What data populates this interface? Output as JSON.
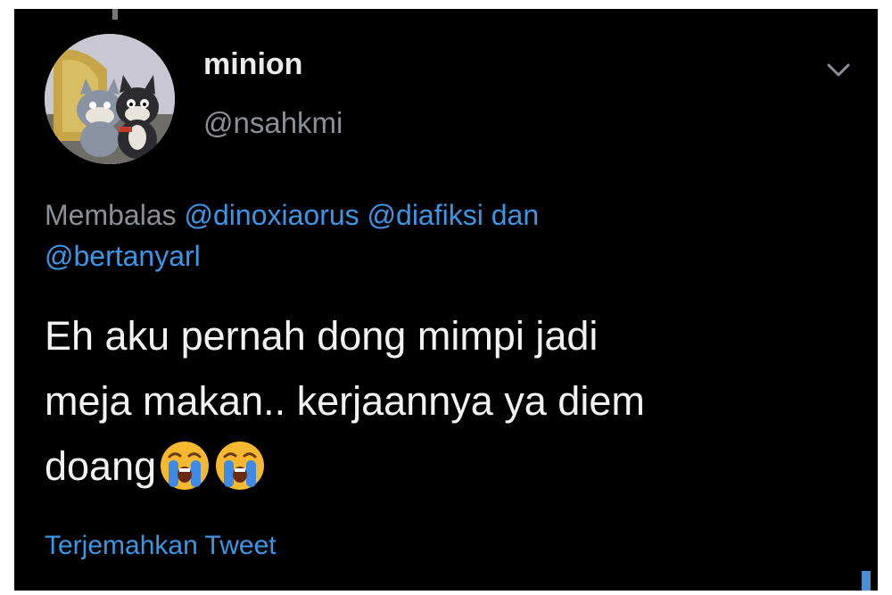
{
  "tweet": {
    "display_name": "minion",
    "handle": "@nsahkmi",
    "reply_prefix": "Membalas",
    "mention_1": "@dinoxiaorus",
    "mention_2": "@diafiksi",
    "mention_joiner": "dan",
    "mention_3": "@bertanyarl",
    "text_line_1": "Eh aku pernah dong mimpi jadi",
    "text_line_2": "meja makan.. kerjaannya ya diem",
    "text_line_3": "doang",
    "emoji": [
      "loudly-crying-face",
      "loudly-crying-face"
    ],
    "translate_label": "Terjemahkan Tweet"
  },
  "icons": {
    "more_menu": "chevron-down-icon"
  },
  "colors": {
    "background": "#000000",
    "name_text": "#ececec",
    "secondary_text": "#8b9095",
    "link_blue": "#3b96e6",
    "body_text": "#f2f2f2"
  }
}
